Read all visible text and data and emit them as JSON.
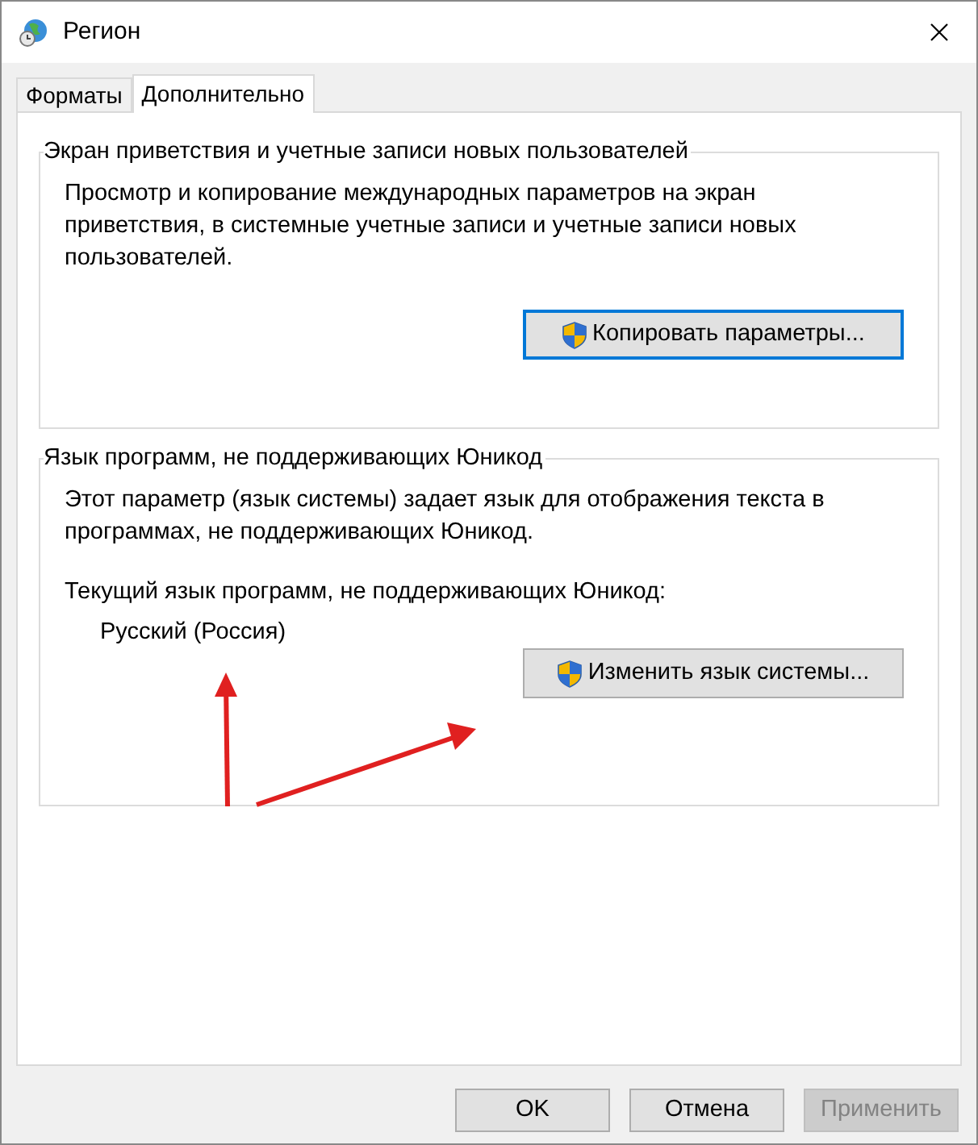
{
  "window": {
    "title": "Регион"
  },
  "tabs": [
    {
      "label": "Форматы",
      "selected": false
    },
    {
      "label": "Дополнительно",
      "selected": true
    }
  ],
  "groups": [
    {
      "title": "Экран приветствия и учетные записи новых пользователей",
      "description": "Просмотр и копирование международных параметров на экран приветствия, в системные учетные записи и учетные записи новых пользователей.",
      "button": {
        "label": "Копировать параметры...",
        "focused": true
      }
    },
    {
      "title": "Язык программ, не поддерживающих Юникод",
      "description": "Этот параметр (язык системы) задает язык для отображения текста в программах, не поддерживающих Юникод.",
      "current_label": "Текущий язык программ, не поддерживающих Юникод:",
      "current_value": "Русский (Россия)",
      "button": {
        "label": "Изменить язык системы...",
        "focused": false
      }
    }
  ],
  "buttons": [
    {
      "label": "OK",
      "disabled": false
    },
    {
      "label": "Отмена",
      "disabled": false
    },
    {
      "label": "Применить",
      "disabled": true
    }
  ]
}
